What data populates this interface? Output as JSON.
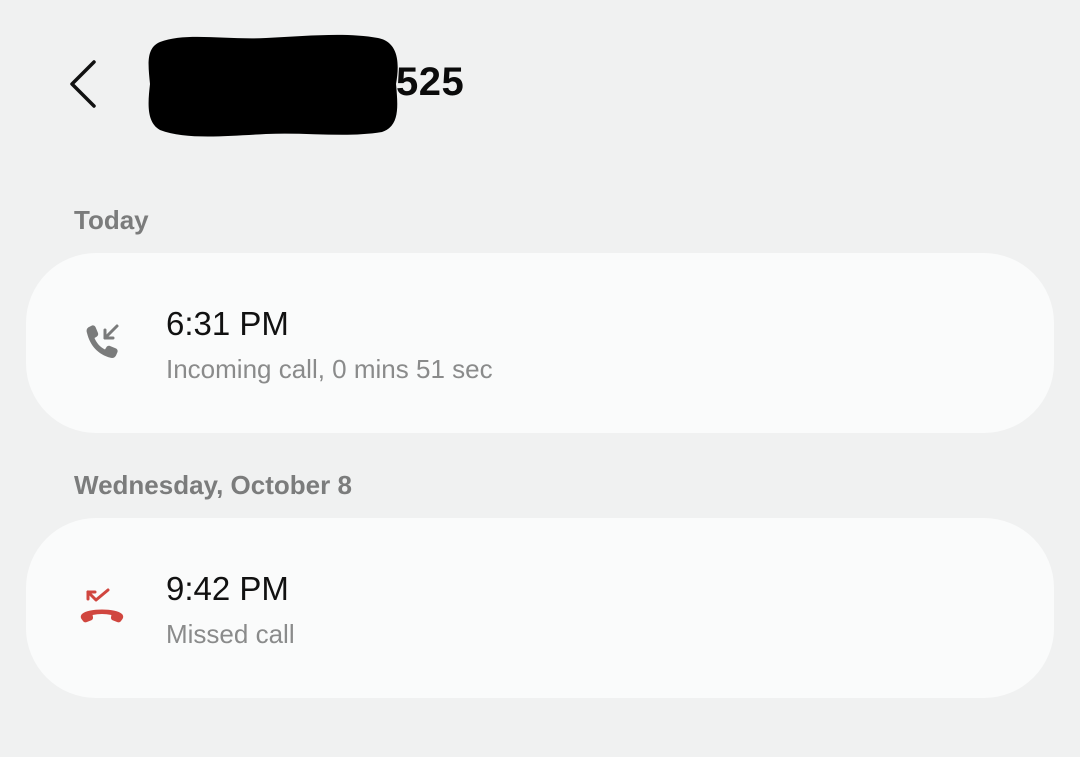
{
  "header": {
    "back_icon": "chevron-left-icon",
    "contact_visible_suffix": "525"
  },
  "sections": [
    {
      "label": "Today",
      "call": {
        "icon": "incoming-call-icon",
        "time": "6:31 PM",
        "detail": "Incoming call, 0 mins 51 sec",
        "icon_color": "#7a7b7b"
      }
    },
    {
      "label": "Wednesday, October 8",
      "call": {
        "icon": "missed-call-icon",
        "time": "9:42 PM",
        "detail": "Missed call",
        "icon_color": "#d0463f"
      }
    }
  ],
  "colors": {
    "background": "#f0f1f1",
    "card": "#fafbfb",
    "secondary_text": "#8a8b8b",
    "section_label": "#7b7c7c",
    "missed": "#d0463f"
  }
}
